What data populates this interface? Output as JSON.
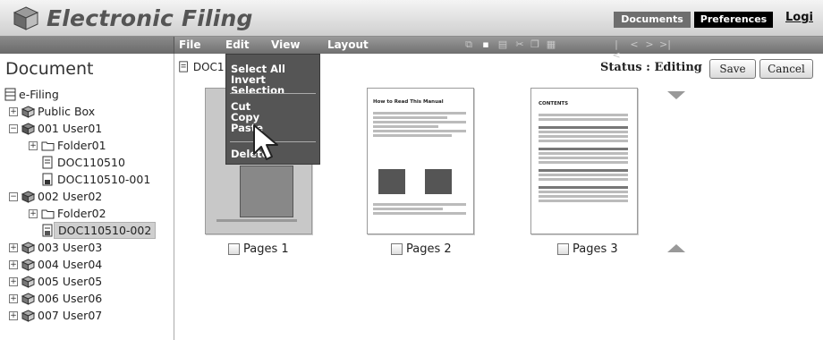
{
  "app": {
    "title": "Electronic Filing"
  },
  "header": {
    "documents_label": "Documents",
    "preferences_label": "Preferences",
    "login_label": "Logi"
  },
  "menubar": {
    "file": "File",
    "edit": "Edit",
    "view": "View",
    "layout": "Layout"
  },
  "sidebar": {
    "title": "Document",
    "root": "e-Filing",
    "items": [
      "Public Box",
      "001 User01",
      "Folder01",
      "DOC110510",
      "DOC110510-001",
      "002 User02",
      "Folder02",
      "DOC110510-002",
      "003 User03",
      "004 User04",
      "005 User05",
      "006 User06",
      "007 User07"
    ]
  },
  "content": {
    "doc_label": "DOC1",
    "status": "Status : Editing",
    "save_label": "Save",
    "cancel_label": "Cancel",
    "pages": [
      "Pages 1",
      "Pages 2",
      "Pages 3"
    ],
    "thumb2_title": "How to Read This Manual",
    "thumb3_title": "CONTENTS"
  },
  "edit_menu": {
    "items": [
      "Select All",
      "Invert Selection",
      "Cut",
      "Copy",
      "Paste",
      "Delete"
    ]
  }
}
